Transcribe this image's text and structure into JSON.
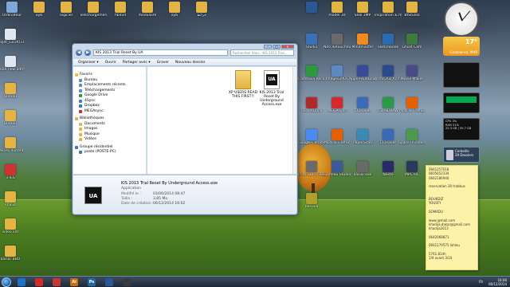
{
  "desktop": {
    "icons_left": [
      {
        "label": "Ordinateur",
        "icon": "computer-icon",
        "color": "#7fa7d8"
      },
      {
        "label": "ayb",
        "icon": "folder-icon",
        "color": "#e3b343"
      },
      {
        "label": "logiciel",
        "icon": "folder-icon",
        "color": "#e3b343"
      },
      {
        "label": "Telechargement",
        "icon": "folder-icon",
        "color": "#e3b343"
      },
      {
        "label": "hbdvd",
        "icon": "folder-icon",
        "color": "#e3b343"
      },
      {
        "label": "modulaire",
        "icon": "folder-icon",
        "color": "#e3b343"
      },
      {
        "label": "ayb",
        "icon": "folder-icon",
        "color": "#e3b343"
      },
      {
        "label": "خرائط",
        "icon": "folder-icon",
        "color": "#e3b343"
      }
    ],
    "icons_column": [
      {
        "label": "Projet_GLORTEC",
        "icon": "document-icon",
        "color": "#dfe7f0"
      },
      {
        "label": "Salah new admi",
        "icon": "document-icon",
        "color": "#dfe7f0"
      },
      {
        "label": "Bureau",
        "icon": "folder-icon",
        "color": "#e3b343"
      },
      {
        "label": "Bureau",
        "icon": "folder-icon",
        "color": "#e3b343"
      },
      {
        "label": "délices dorient",
        "icon": "folder-icon",
        "color": "#e3b343"
      },
      {
        "label": "3.IES",
        "icon": "pdf-icon",
        "color": "#c33"
      },
      {
        "label": "khalid",
        "icon": "folder-icon",
        "color": "#e3b343"
      },
      {
        "label": "video kdr",
        "icon": "folder-icon",
        "color": "#e3b343"
      },
      {
        "label": "kaisar BBO",
        "icon": "folder-icon",
        "color": "#e3b343"
      }
    ],
    "icons_right": [
      {
        "label": "",
        "icon": "word-icon",
        "color": "#2b5797"
      },
      {
        "label": "model 3d",
        "icon": "folder-icon",
        "color": "#e3b343"
      },
      {
        "label": "Seal 3MP",
        "icon": "folder-icon",
        "color": "#e3b343"
      },
      {
        "label": "inspiration & modell",
        "icon": "folder-icon",
        "color": "#e3b343"
      },
      {
        "label": "BtStudio",
        "icon": "folder-icon",
        "color": "#e3b343"
      },
      {
        "label": "Studio",
        "icon": "app-icon",
        "color": "#3a70b8"
      },
      {
        "label": "Neo Retoucheur",
        "icon": "app-icon",
        "color": "#6a6a6a"
      },
      {
        "label": "Mindmaster",
        "icon": "app-icon",
        "color": "#f08a1c"
      },
      {
        "label": "Sketchbook",
        "icon": "app-icon",
        "color": "#2a6ab0"
      },
      {
        "label": "Ghost Cam",
        "icon": "app-icon",
        "color": "#3d7a3d"
      },
      {
        "label": "Camtasia Recorder",
        "icon": "app-icon",
        "color": "#2a9a3a"
      },
      {
        "label": "Images2PDF",
        "icon": "app-icon",
        "color": "#5a8ac0"
      },
      {
        "label": "Apps+Autoplay Racccourci",
        "icon": "app-icon",
        "color": "#3a4a9a"
      },
      {
        "label": "ArchiCAD Architecture",
        "icon": "app-icon",
        "color": "#2a4a8a"
      },
      {
        "label": "Movie Maker",
        "icon": "app-icon",
        "color": "#4a4a8a"
      },
      {
        "label": "RocketDock",
        "icon": "app-icon",
        "color": "#b02a2a"
      },
      {
        "label": "MEGAsync",
        "icon": "app-icon",
        "color": "#d9272e"
      },
      {
        "label": "CCleaner",
        "icon": "app-icon",
        "color": "#3a6ab8"
      },
      {
        "label": "CorelDRAW",
        "icon": "app-icon",
        "color": "#2a9a4a"
      },
      {
        "label": "Mozilla Firefox",
        "icon": "firefox-icon",
        "color": "#e66000"
      },
      {
        "label": "Google Chrome",
        "icon": "chrome-icon",
        "color": "#4a8af4"
      },
      {
        "label": "Mozilla Firefox",
        "icon": "firefox-icon",
        "color": "#e66000"
      },
      {
        "label": "PaperScan",
        "icon": "app-icon",
        "color": "#3a8ab8"
      },
      {
        "label": "CCleaner",
        "icon": "app-icon",
        "color": "#3a6ab8"
      },
      {
        "label": "Space Invaders",
        "icon": "app-icon",
        "color": "#4a9a4a"
      },
      {
        "label": "Prim Fabric Retrieval",
        "icon": "app-icon",
        "color": "#6a6a6a"
      },
      {
        "label": "Sameau Studio",
        "icon": "app-icon",
        "color": "#3a5a9a"
      },
      {
        "label": "kaisar.exe",
        "icon": "app-icon",
        "color": "#6a6a6a"
      },
      {
        "label": "Nexte",
        "icon": "app-icon",
        "color": "#2a2a6a"
      },
      {
        "label": "MPC-HC",
        "icon": "app-icon",
        "color": "#2a3a5a"
      },
      {
        "label": "Recuva",
        "icon": "app-icon",
        "color": "#b0a02a"
      }
    ]
  },
  "explorer": {
    "address": "KIS 2013 Trial Reset By UA",
    "search_placeholder": "Rechercher dans : KIS 2013 Trial...",
    "toolbar": [
      "Organiser ▾",
      "Ouvrir",
      "Partager avec ▾",
      "Graver",
      "Nouveau dossier"
    ],
    "nav": [
      {
        "label": "Favoris",
        "group": true,
        "color": "#f2c13a"
      },
      {
        "label": "Bureau",
        "group": false,
        "color": "#5a8ad0"
      },
      {
        "label": "Emplacements récents",
        "group": false,
        "color": "#5a8ad0"
      },
      {
        "label": "Téléchargements",
        "group": false,
        "color": "#5a8ad0"
      },
      {
        "label": "Google Drive",
        "group": false,
        "color": "#2a9a4a"
      },
      {
        "label": "4Sync",
        "group": false,
        "color": "#4a7ad0"
      },
      {
        "label": "Dropbox",
        "group": false,
        "color": "#2a7ad8"
      },
      {
        "label": "MEGAsync",
        "group": false,
        "color": "#d9272e"
      },
      {
        "label": "Bibliothèques",
        "group": true,
        "color": "#e3b343"
      },
      {
        "label": "Documents",
        "group": false,
        "color": "#e3b343"
      },
      {
        "label": "Images",
        "group": false,
        "color": "#e3b343"
      },
      {
        "label": "Musique",
        "group": false,
        "color": "#e3b343"
      },
      {
        "label": "Vidéos",
        "group": false,
        "color": "#e3b343"
      },
      {
        "label": "Groupe résidentiel",
        "group": true,
        "color": "#3a7ac8"
      },
      {
        "label": "poste (POSTE-PC)",
        "group": false,
        "color": "#3a7ac8"
      }
    ],
    "files": [
      {
        "name": "XP USERS READ THIS FIRST!!",
        "type": "folder"
      },
      {
        "name": "KIS 2013 Trial Reset By Underground Access.exe",
        "type": "exe",
        "logo": "UA"
      }
    ],
    "details": {
      "logo": "UA",
      "name": "KIS 2013 Trial Reset By Underground Access.exe",
      "type": "Application",
      "rows": [
        {
          "k": "Modifié le :",
          "v": "03/06/2014 08:47"
        },
        {
          "k": "Taille :",
          "v": "3,85 Mo"
        },
        {
          "k": "Date de création :",
          "v": "06/12/2014 16:02"
        }
      ]
    }
  },
  "gadgets": {
    "weather_temp": "17°",
    "weather_city": "Casablanca, MAR",
    "stats_lines": [
      "CPU 3%",
      "RAM 31%",
      "25.3 GB | 59.7 GB"
    ],
    "recycle_label": "Corbeille",
    "recycle_count": "29 Dossiers"
  },
  "sticky_note": [
    "0661257018",
    "0605652334",
    "0662186940",
    "",
    "reservation  30 trabbus",
    "",
    "",
    "BOUKDIZ",
    "YOUSFY",
    "",
    "SOMADU",
    "",
    "www.@mail.com",
    "khadija.dakar@gmail.com",
    "khadija2013",
    "",
    "0642068871",
    "",
    "0661179575 lahlou",
    "",
    "5761.81dh",
    "1/9 avant 3/10"
  ],
  "taskbar": {
    "buttons": [
      {
        "label": "",
        "color": "#1a73c4",
        "icon": "explorer-icon"
      },
      {
        "label": "",
        "color": "#d9272e",
        "icon": "media-icon"
      },
      {
        "label": "",
        "color": "#c33",
        "icon": "opera-icon"
      },
      {
        "label": "Ai",
        "color": "#c86c0c",
        "icon": "illustrator-icon"
      },
      {
        "label": "Ps",
        "color": "#1d6aa5",
        "icon": "photoshop-icon"
      },
      {
        "label": "",
        "color": "#2b5797",
        "icon": "word-icon"
      },
      {
        "label": "",
        "color": "#3a3a3a",
        "icon": "app-icon"
      }
    ],
    "lang": "FR",
    "time": "16:06",
    "date": "06/12/2014"
  }
}
